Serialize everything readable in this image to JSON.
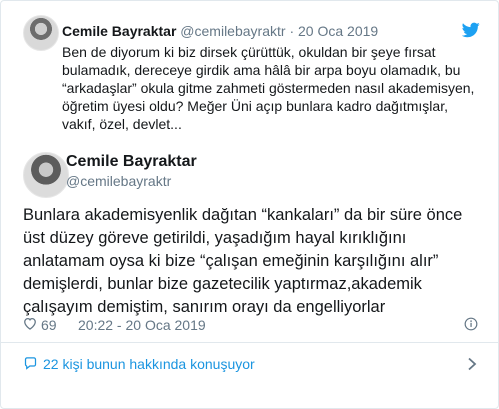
{
  "quoted_tweet": {
    "name": "Cemile Bayraktar",
    "handle": "@cemilebayraktr",
    "separator": "·",
    "date": "20 Oca 2019",
    "text": "Ben de diyorum ki biz dirsek çürüttük, okuldan bir şeye fırsat bulamadık, dereceye girdik  ama hâlâ bir arpa boyu olamadık, bu “arkadaşlar” okula gitme zahmeti göstermeden nasıl akademisyen, öğretim üyesi oldu? Meğer Üni açıp bunlara kadro dağıtmışlar, vakıf, özel, devlet..."
  },
  "tweet": {
    "name": "Cemile Bayraktar",
    "handle": "@cemilebayraktr",
    "text": "Bunlara akademisyenlik dağıtan “kankaları” da bir süre önce üst düzey göreve getirildi, yaşadığım hayal kırıklığını anlatamam oysa ki bize  “çalışan emeğinin karşılığını alır” demişlerdi, bunlar bize gazetecilik yaptırmaz,akademik çalışayım demiştim, sanırım orayı da engelliyorlar",
    "likes": "69",
    "timestamp": "20:22 - 20 Oca 2019"
  },
  "conversation": {
    "label": "22 kişi bunun hakkında konuşuyor"
  },
  "icons": {
    "brand": "twitter-bird-icon",
    "like": "heart-icon",
    "info": "info-icon",
    "reply": "speech-bubble-icon",
    "more": "chevron-right-icon"
  },
  "colors": {
    "accent": "#1da1f2",
    "link": "#1b95e0",
    "text": "#14171a",
    "muted": "#657786",
    "border": "#e1e8ed"
  }
}
